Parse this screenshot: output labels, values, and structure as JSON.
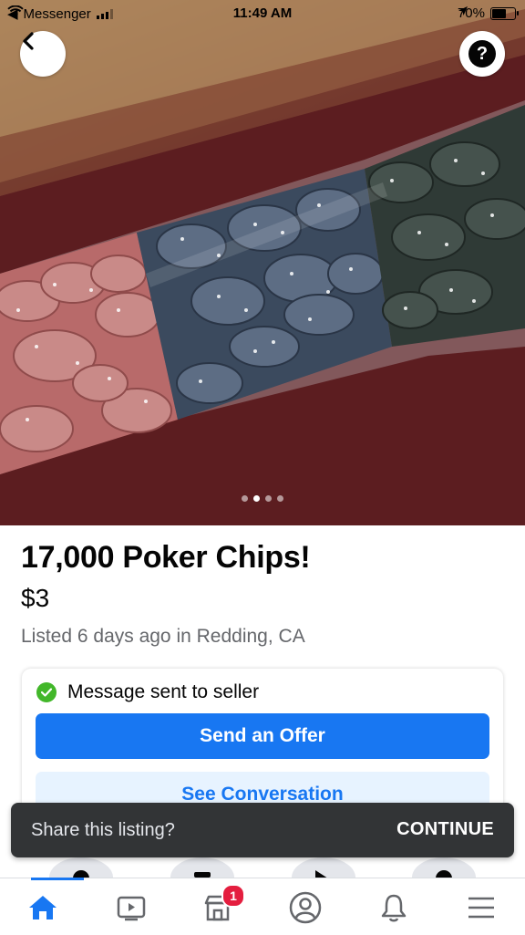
{
  "status_bar": {
    "back_app": "Messenger",
    "time": "11:49 AM",
    "battery": "70%",
    "battery_level": 0.7
  },
  "photo": {
    "image_count": 4,
    "active_index": 1
  },
  "listing": {
    "title": "17,000 Poker Chips!",
    "price": "$3",
    "meta": "Listed 6 days ago in Redding, CA"
  },
  "seller_card": {
    "message_status": "Message sent to seller",
    "offer_label": "Send an Offer",
    "conversation_label": "See Conversation"
  },
  "snackbar": {
    "text": "Share this listing?",
    "action": "CONTINUE"
  },
  "tabbar": {
    "items": [
      {
        "name": "Home",
        "icon": "home-icon"
      },
      {
        "name": "Watch",
        "icon": "video-icon"
      },
      {
        "name": "Marketplace",
        "icon": "marketplace-icon",
        "badge": "1"
      },
      {
        "name": "Profile",
        "icon": "profile-icon"
      },
      {
        "name": "Notifications",
        "icon": "bell-icon"
      },
      {
        "name": "Menu",
        "icon": "menu-icon"
      }
    ]
  },
  "colors": {
    "accent": "#1877f2",
    "success": "#42b72a",
    "badge": "#e41e3f"
  }
}
